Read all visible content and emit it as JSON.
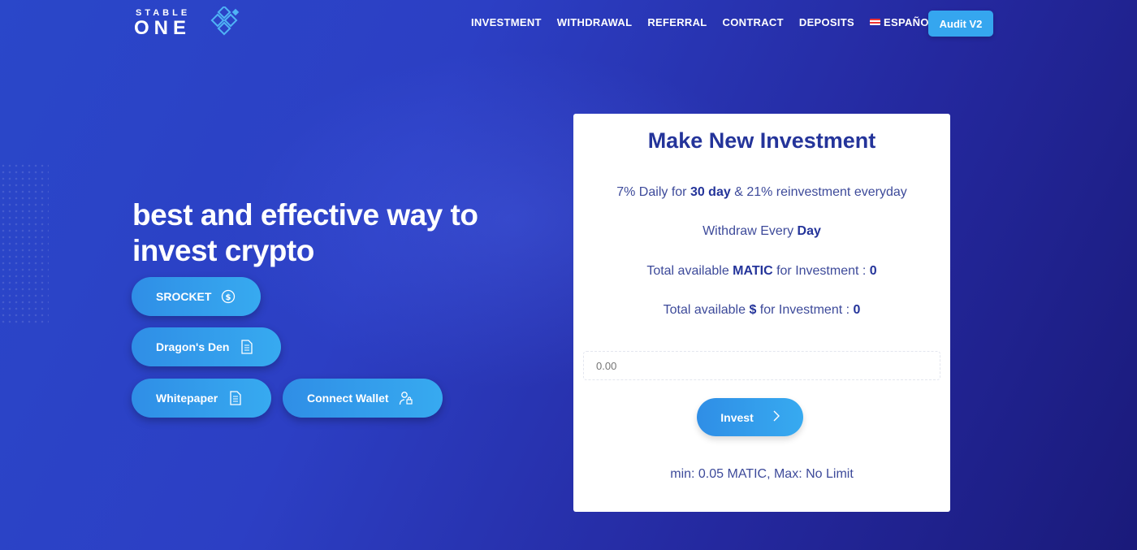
{
  "brand": {
    "logo_top": "STABLE",
    "logo_bottom": "ONE"
  },
  "nav": {
    "items": [
      "INVESTMENT",
      "WITHDRAWAL",
      "REFERRAL",
      "CONTRACT",
      "DEPOSITS"
    ],
    "language": "ESPAÑOL",
    "audit": "Audit V2"
  },
  "hero": {
    "headline_1": "best and effective way to",
    "headline_2": "invest crypto",
    "buttons": {
      "srocket": "SROCKET",
      "dragons_den": "Dragon's Den",
      "whitepaper": "Whitepaper",
      "connect_wallet": "Connect Wallet"
    }
  },
  "card": {
    "title": "Make New Investment",
    "line1": {
      "pre": "7% Daily for ",
      "bold": "30 day",
      "post": " & 21% reinvestment everyday"
    },
    "line2": {
      "pre": "Withdraw Every ",
      "bold": "Day"
    },
    "line3": {
      "pre": "Total available ",
      "bold": "MATIC",
      "mid": " for Investment : ",
      "value": "0"
    },
    "line4": {
      "pre": "Total available ",
      "bold": "$",
      "mid": " for Investment : ",
      "value": "0"
    },
    "amount_placeholder": "0.00",
    "invest_label": "Invest",
    "limits": "min: 0.05 MATIC, Max: No Limit"
  },
  "colors": {
    "accent": "#35a6ef",
    "card_text": "#24349a",
    "bg_start": "#2a47c9",
    "bg_end": "#1a1a7a"
  }
}
